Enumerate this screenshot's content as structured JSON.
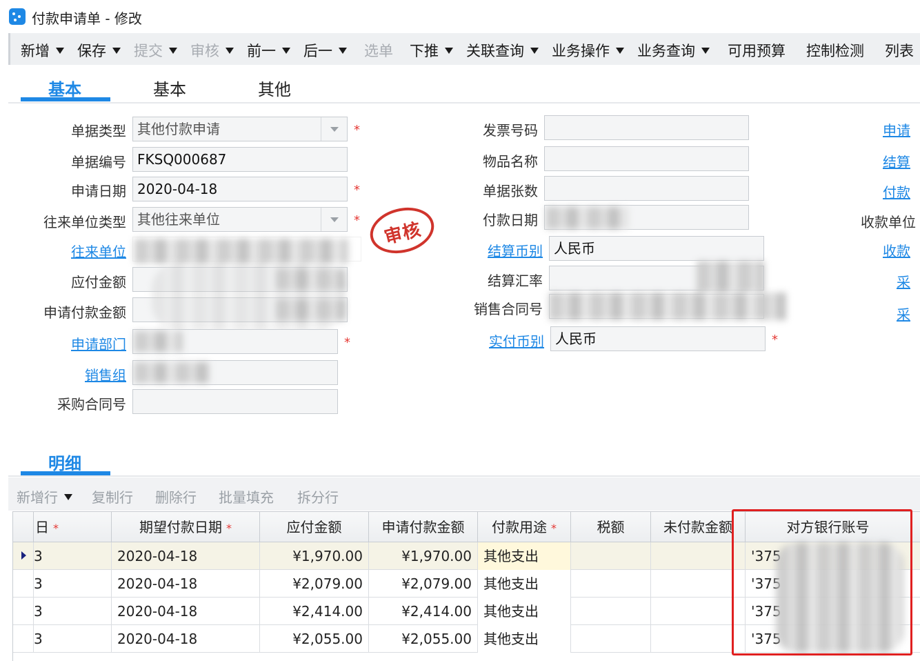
{
  "window": {
    "title": "付款申请单 - 修改"
  },
  "toolbar": {
    "new": "新增",
    "save": "保存",
    "submit": "提交",
    "audit": "审核",
    "prev": "前一",
    "next": "后一",
    "select_bill": "选单",
    "push_down": "下推",
    "related_query": "关联查询",
    "biz_operation": "业务操作",
    "biz_query": "业务查询",
    "available_budget": "可用预算",
    "control_check": "控制检测",
    "list": "列表"
  },
  "tabs": [
    "基本",
    "基本",
    "其他"
  ],
  "form": {
    "bill_type": {
      "label": "单据类型",
      "value": "其他付款申请"
    },
    "bill_no": {
      "label": "单据编号",
      "value": "FKSQ000687"
    },
    "apply_date": {
      "label": "申请日期",
      "value": "2020-04-18"
    },
    "partner_type": {
      "label": "往来单位类型",
      "value": "其他往来单位"
    },
    "partner": {
      "label": "往来单位"
    },
    "payable_amount": {
      "label": "应付金额"
    },
    "apply_pay_amount": {
      "label": "申请付款金额"
    },
    "apply_dept": {
      "label": "申请部门"
    },
    "sales_group": {
      "label": "销售组"
    },
    "purchase_contract": {
      "label": "采购合同号"
    },
    "invoice_no": {
      "label": "发票号码"
    },
    "item_name": {
      "label": "物品名称"
    },
    "bill_count": {
      "label": "单据张数"
    },
    "pay_date": {
      "label": "付款日期"
    },
    "settle_currency": {
      "label": "结算币别",
      "value": "人民币"
    },
    "settle_rate": {
      "label": "结算汇率"
    },
    "sales_contract": {
      "label": "销售合同号"
    },
    "actual_currency": {
      "label": "实付币别",
      "value": "人民币"
    },
    "required_mark": "*"
  },
  "right_links": [
    "申请",
    "结算",
    "付款",
    "收款单位",
    "收款",
    "采",
    "采"
  ],
  "stamp": {
    "text": "审核",
    "color": "#d0342c"
  },
  "detail": {
    "title": "明细",
    "toolbar": [
      "新增行",
      "复制行",
      "删除行",
      "批量填充",
      "拆分行"
    ],
    "columns": [
      "日",
      "期望付款日期",
      "应付金额",
      "申请付款金额",
      "付款用途",
      "税额",
      "未付款金额",
      "对方银行账号"
    ],
    "required_mark": "*",
    "rows": [
      {
        "day": "3",
        "date": "2020-04-18",
        "payable": "¥1,970.00",
        "apply": "¥1,970.00",
        "purpose": "其他支出",
        "account": "'375"
      },
      {
        "day": "3",
        "date": "2020-04-18",
        "payable": "¥2,079.00",
        "apply": "¥2,079.00",
        "purpose": "其他支出",
        "account": "'375"
      },
      {
        "day": "3",
        "date": "2020-04-18",
        "payable": "¥2,414.00",
        "apply": "¥2,414.00",
        "purpose": "其他支出",
        "account": "'375"
      },
      {
        "day": "3",
        "date": "2020-04-18",
        "payable": "¥2,055.00",
        "apply": "¥2,055.00",
        "purpose": "其他支出",
        "account": "'375"
      }
    ]
  },
  "colors": {
    "accent": "#1e88e5",
    "required": "#e53935",
    "highlight": "#e02020"
  }
}
